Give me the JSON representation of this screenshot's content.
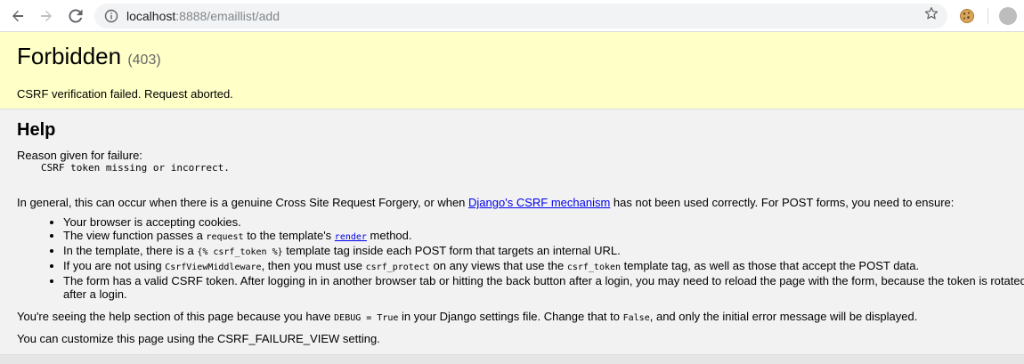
{
  "browser": {
    "url_host": "localhost",
    "url_rest": ":8888/emaillist/add",
    "icons": {
      "back": "back-arrow-icon",
      "forward": "forward-arrow-icon",
      "reload": "reload-icon",
      "site_info": "info-icon",
      "bookmark": "star-icon",
      "extension": "cookie-icon",
      "profile": "avatar"
    }
  },
  "summary": {
    "title": "Forbidden",
    "code": "(403)",
    "message": "CSRF verification failed. Request aborted.",
    "background": "#ffffc8"
  },
  "help": {
    "heading": "Help",
    "reason_label": "Reason given for failure:",
    "reason_value": "CSRF token missing or incorrect.",
    "general_before": "In general, this can occur when there is a genuine Cross Site Request Forgery, or when ",
    "general_link": "Django's CSRF mechanism",
    "general_after": " has not been used correctly. For POST forms, you need to ensure:",
    "items": [
      {
        "text": "Your browser is accepting cookies."
      },
      {
        "t1": "The view function passes a ",
        "c1": "request",
        "t2": " to the template's ",
        "link": "render",
        "t3": " method."
      },
      {
        "t1": "In the template, there is a ",
        "c1": "{% csrf_token %}",
        "t2": " template tag inside each POST form that targets an internal URL."
      },
      {
        "t1": "If you are not using ",
        "c1": "CsrfViewMiddleware",
        "t2": ", then you must use ",
        "c2": "csrf_protect",
        "t3": " on any views that use the ",
        "c3": "csrf_token",
        "t4": " template tag, as well as those that accept the POST data."
      },
      {
        "text": "The form has a valid CSRF token. After logging in in another browser tab or hitting the back button after a login, you may need to reload the page with the form, because the token is rotated after a login."
      }
    ],
    "debug_before": "You're seeing the help section of this page because you have ",
    "debug_code": "DEBUG = True",
    "debug_mid": " in your Django settings file. Change that to ",
    "debug_code2": "False",
    "debug_after": ", and only the initial error message will be displayed.",
    "customize": "You can customize this page using the CSRF_FAILURE_VIEW setting.",
    "link_color": "#0000ee"
  }
}
